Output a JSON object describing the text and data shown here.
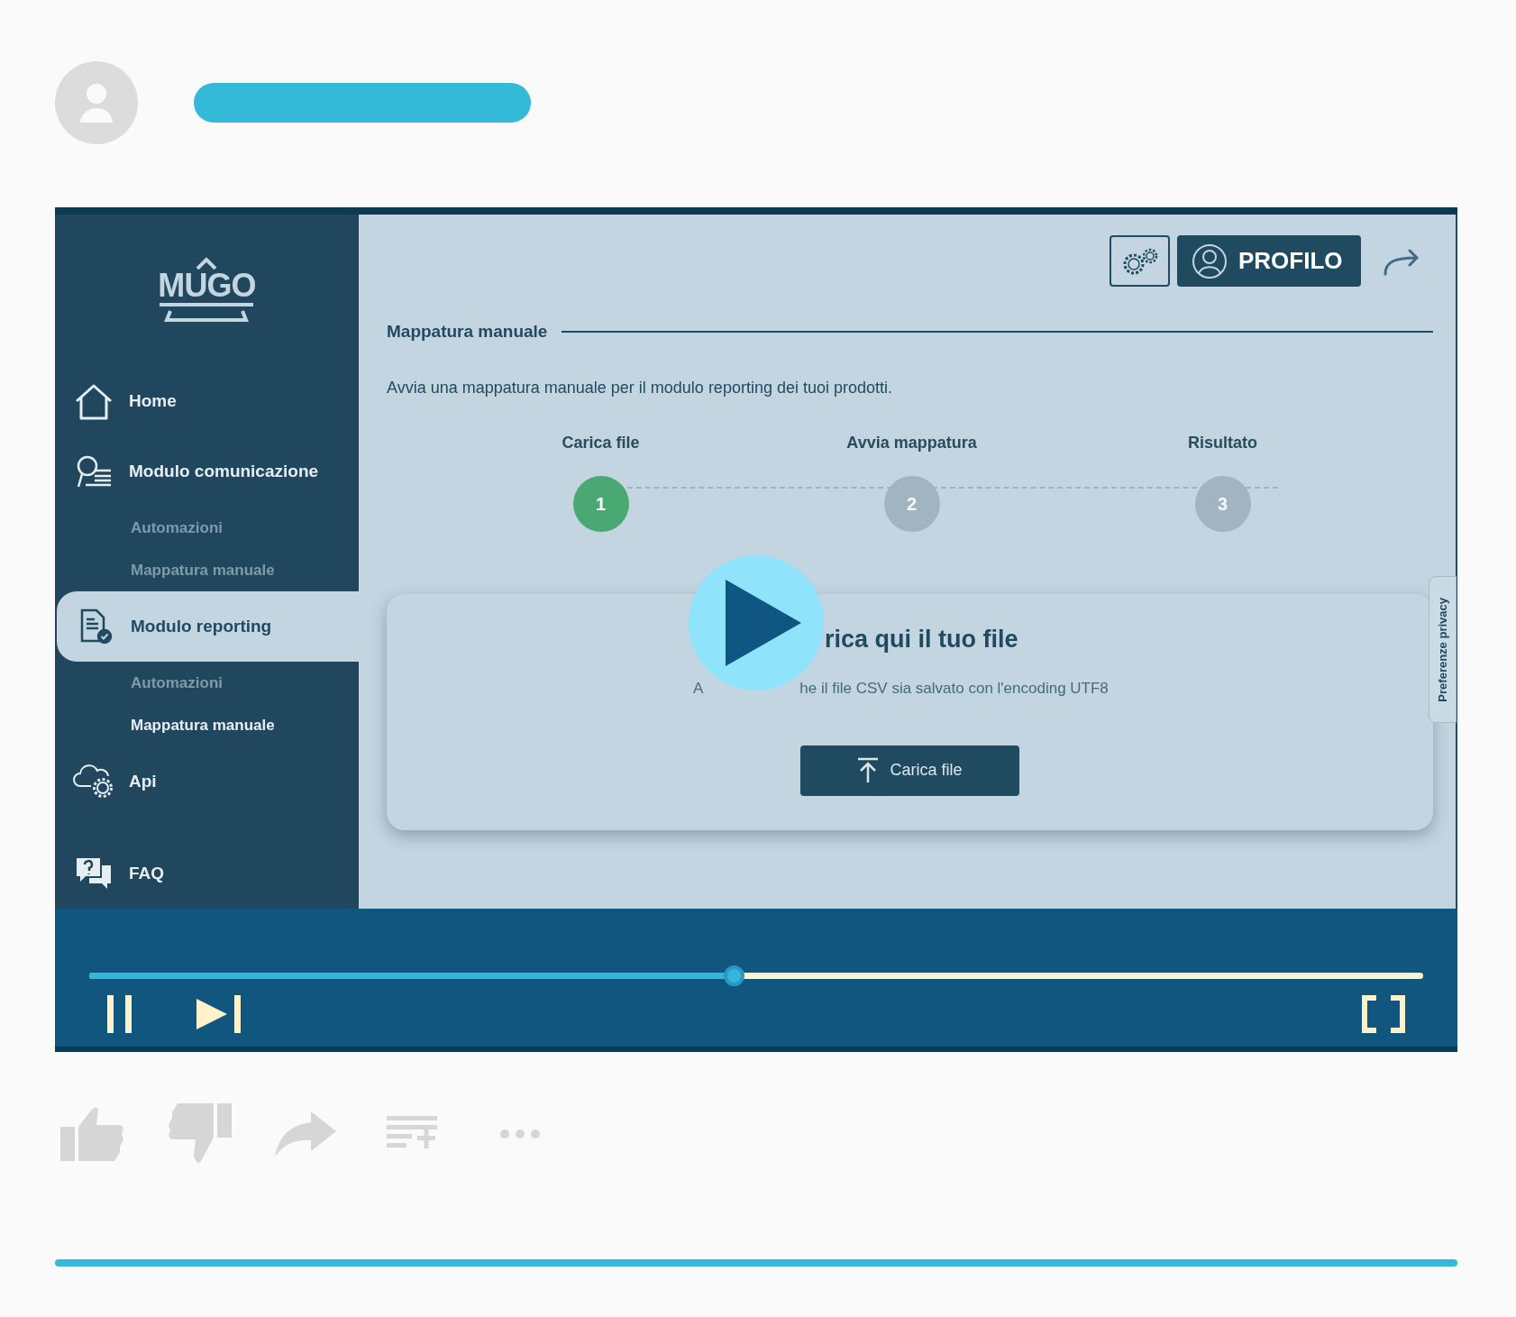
{
  "video": {
    "playing": true,
    "progress": {
      "level": 0.483
    },
    "app": {
      "logo": "MUGO",
      "sidebar": {
        "items": [
          {
            "label": "Home",
            "selected": false
          },
          {
            "label": "Modulo comunicazione",
            "selected": false,
            "children": [
              {
                "label": "Automazioni",
                "selected": false
              },
              {
                "label": "Mappatura manuale",
                "selected": false
              }
            ]
          },
          {
            "label": "Modulo reporting",
            "selected": true,
            "children": [
              {
                "label": "Automazioni",
                "selected": false
              },
              {
                "label": "Mappatura manuale",
                "selected": true
              }
            ]
          },
          {
            "label": "Api",
            "selected": false
          },
          {
            "label": "FAQ",
            "selected": false
          }
        ]
      },
      "profile_button": "PROFILO",
      "section_title": "Mappatura manuale",
      "description": "Avvia una mappatura manuale per il modulo reporting dei tuoi prodotti.",
      "steps": [
        {
          "label": "Carica file",
          "number": "1",
          "selected": true
        },
        {
          "label": "Avvia mappatura",
          "number": "2",
          "selected": false
        },
        {
          "label": "Risultato",
          "number": "3",
          "selected": false
        }
      ],
      "upload_card": {
        "title": "rica qui il tuo file",
        "hint_start": "A",
        "hint_end": "he il file CSV sia salvato con l'encoding UTF8",
        "button": "Carica file"
      },
      "privacy_tab": "Preferenze privacy"
    }
  }
}
